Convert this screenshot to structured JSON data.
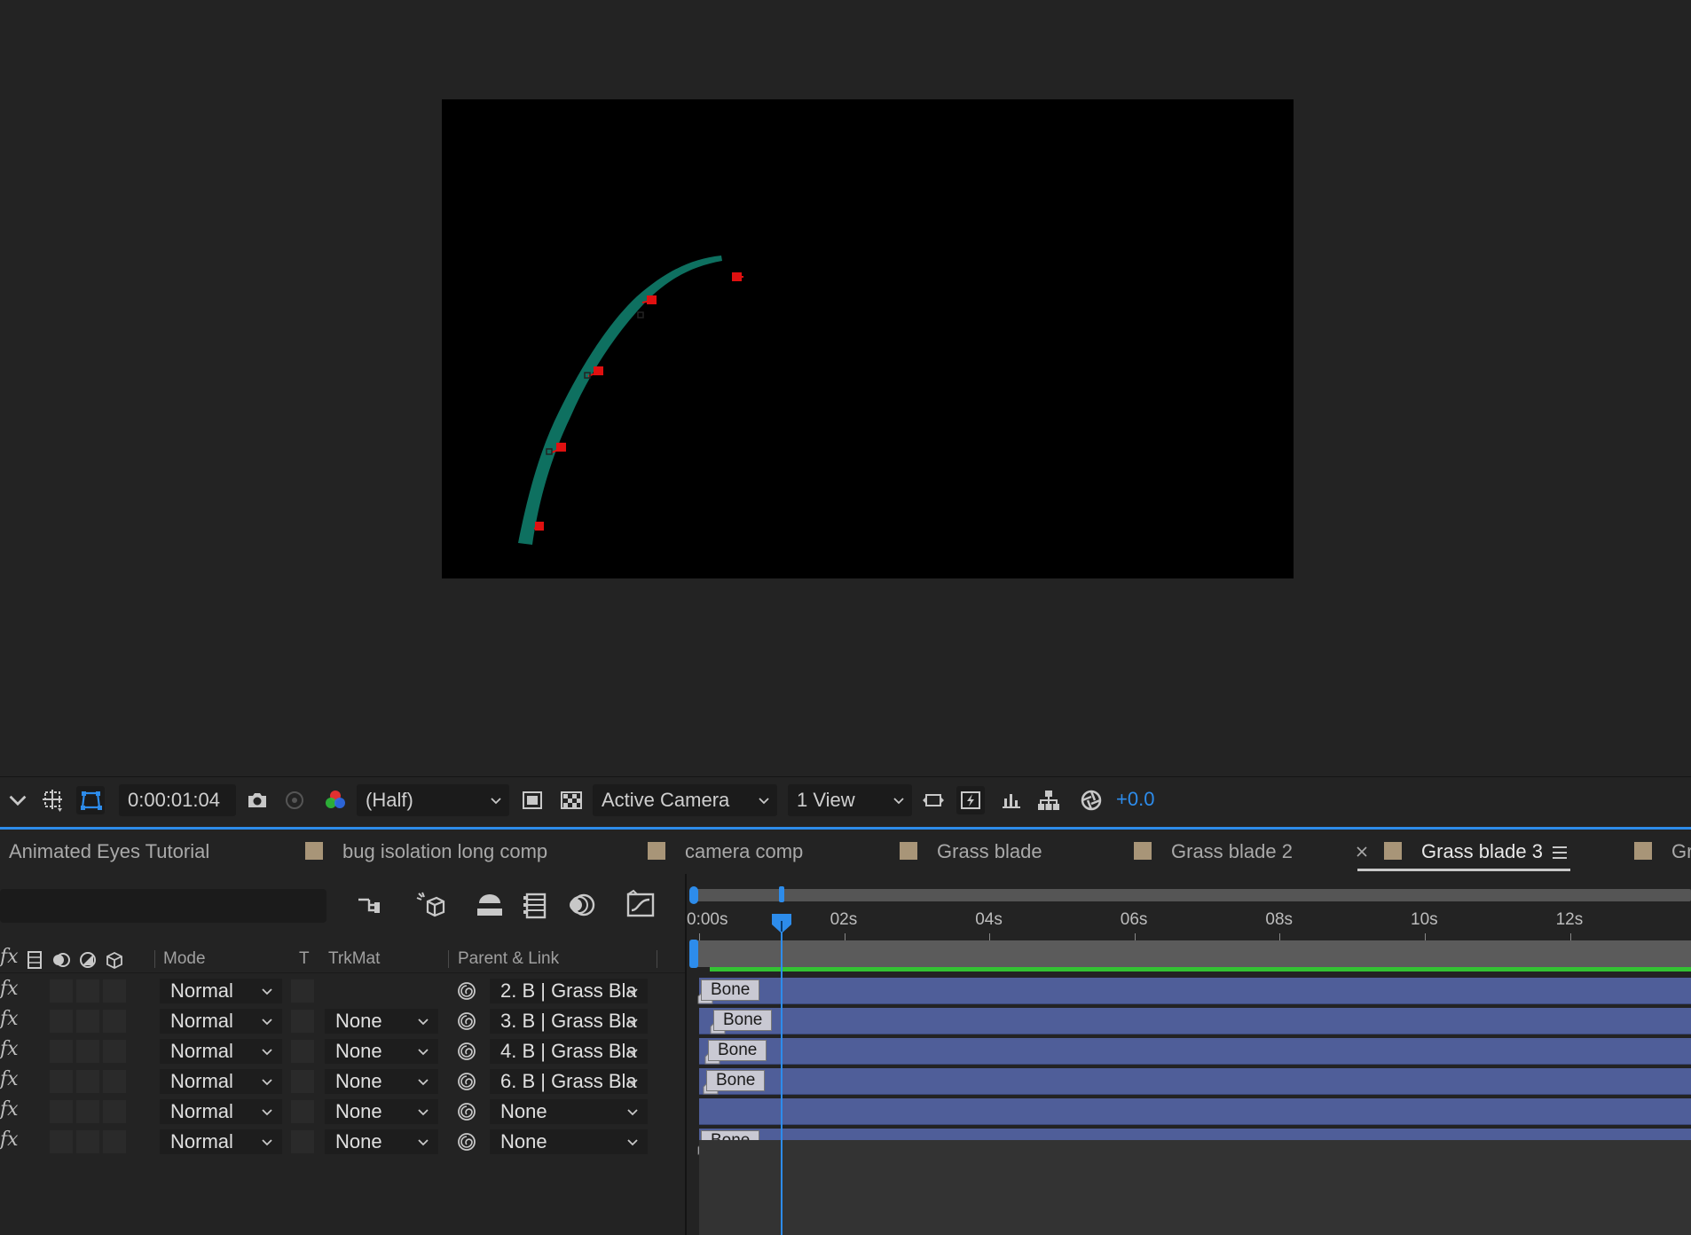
{
  "toolbar": {
    "timecode": "0:00:01:04",
    "resolution": "(Half)",
    "camera": "Active Camera",
    "view_layout": "1 View",
    "exposure": "+0.0"
  },
  "tabs": [
    {
      "label": "Animated Eyes Tutorial"
    },
    {
      "label": "bug isolation long comp"
    },
    {
      "label": "camera comp"
    },
    {
      "label": "Grass blade"
    },
    {
      "label": "Grass blade 2"
    },
    {
      "label": "Grass blade 3"
    },
    {
      "label": "Gr"
    }
  ],
  "columns": {
    "fx": "fx",
    "mode": "Mode",
    "t": "T",
    "trkmat": "TrkMat",
    "parent": "Parent & Link"
  },
  "layers": [
    {
      "mode": "Normal",
      "trkmat": "",
      "parent": "2. B | Grass Bla",
      "bone_label": "Bone"
    },
    {
      "mode": "Normal",
      "trkmat": "None",
      "parent": "3. B | Grass Bla",
      "bone_label": "Bone"
    },
    {
      "mode": "Normal",
      "trkmat": "None",
      "parent": "4. B | Grass Bla",
      "bone_label": "Bone"
    },
    {
      "mode": "Normal",
      "trkmat": "None",
      "parent": "6. B | Grass Bla",
      "bone_label": "Bone"
    },
    {
      "mode": "Normal",
      "trkmat": "None",
      "parent": "None",
      "bone_label": ""
    },
    {
      "mode": "Normal",
      "trkmat": "None",
      "parent": "None",
      "bone_label": "Bone"
    }
  ],
  "ruler": [
    "0:00s",
    "02s",
    "04s",
    "06s",
    "08s",
    "10s",
    "12s"
  ],
  "colors": {
    "accent": "#2d8ceb",
    "layer_bar": "#4f5e99",
    "tab_swatch": "#a89578",
    "grass": "#0e7060",
    "bone_handle": "#e01010"
  }
}
